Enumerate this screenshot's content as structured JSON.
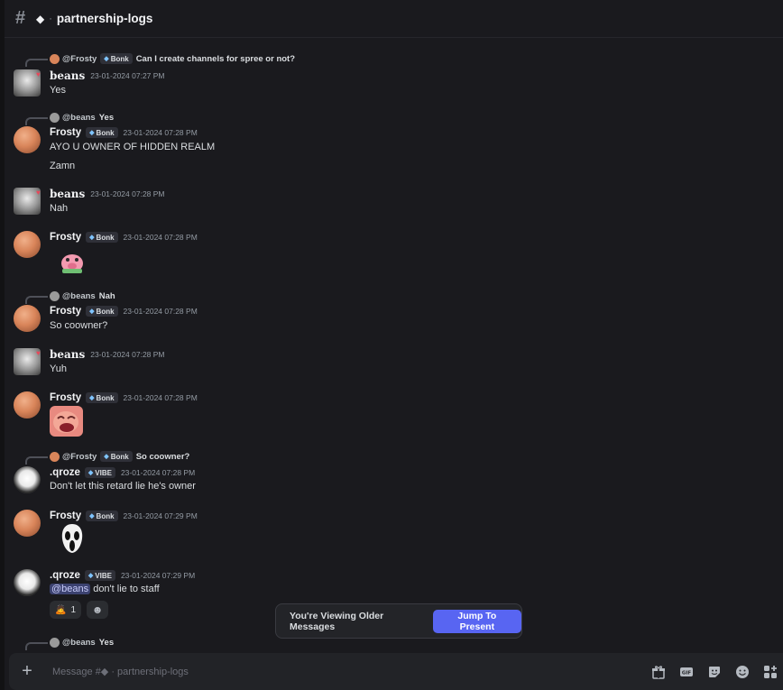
{
  "header": {
    "channel_name": "partnership-logs"
  },
  "messages": [
    {
      "reply": {
        "name": "@Frosty",
        "tag": "Bonk",
        "text": "Can I create channels for spree or not?"
      },
      "author": "beans",
      "time": "23-01-2024 07:27 PM",
      "lines": [
        "Yes"
      ]
    },
    {
      "reply": {
        "name": "@beans",
        "text": "Yes"
      },
      "author": "Frosty",
      "tag": "Bonk",
      "time": "23-01-2024 07:28 PM",
      "lines": [
        "AYO U OWNER OF HIDDEN REALM",
        "Zamn"
      ]
    },
    {
      "author": "beans",
      "time": "23-01-2024 07:28 PM",
      "lines": [
        "Nah"
      ]
    },
    {
      "author": "Frosty",
      "tag": "Bonk",
      "time": "23-01-2024 07:28 PM",
      "sticker": "pink-pig-sticker"
    },
    {
      "reply": {
        "name": "@beans",
        "text": "Nah"
      },
      "author": "Frosty",
      "tag": "Bonk",
      "time": "23-01-2024 07:28 PM",
      "lines": [
        "So coowner?"
      ]
    },
    {
      "author": "beans",
      "time": "23-01-2024 07:28 PM",
      "lines": [
        "Yuh"
      ]
    },
    {
      "author": "Frosty",
      "tag": "Bonk",
      "time": "23-01-2024 07:28 PM",
      "sticker": "laughing-face-image"
    },
    {
      "reply": {
        "name": "@Frosty",
        "tag": "Bonk",
        "text": "So coowner?"
      },
      "author": ".qroze",
      "tag": "VIBE",
      "time": "23-01-2024 07:28 PM",
      "lines": [
        "Don't let this retard lie he's owner"
      ]
    },
    {
      "author": "Frosty",
      "tag": "Bonk",
      "time": "23-01-2024 07:29 PM",
      "sticker": "ghost-face-sticker"
    },
    {
      "author": ".qroze",
      "tag": "VIBE",
      "time": "23-01-2024 07:29 PM",
      "mention": "@beans",
      "mention_rest": " don't lie to staff",
      "reaction_count": "1"
    },
    {
      "reply": {
        "name": "@beans",
        "text": "Yes"
      }
    }
  ],
  "older_bar": {
    "text": "You're Viewing Older Messages",
    "button": "Jump To Present"
  },
  "composer": {
    "placeholder": "Message #◆ · partnership-logs"
  },
  "tools": [
    "gift-icon",
    "gif-icon",
    "sticker-icon",
    "emoji-icon",
    "apps-icon"
  ],
  "colors": {
    "accent": "#5865f2",
    "background": "#1a1a1e",
    "mention_bg": "#3c4270"
  }
}
